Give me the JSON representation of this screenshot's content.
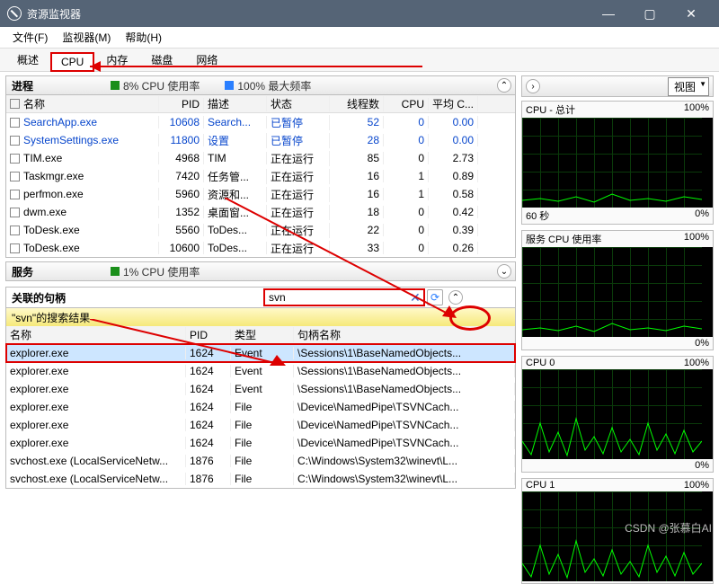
{
  "window": {
    "title": "资源监视器"
  },
  "menu": {
    "file": "文件(F)",
    "monitor": "监视器(M)",
    "help": "帮助(H)"
  },
  "tabs": [
    "概述",
    "CPU",
    "内存",
    "磁盘",
    "网络"
  ],
  "proc_panel": {
    "title": "进程",
    "m1": "8% CPU 使用率",
    "m2": "100% 最大频率"
  },
  "proc_headers": [
    "名称",
    "PID",
    "描述",
    "状态",
    "线程数",
    "CPU",
    "平均 C..."
  ],
  "processes": [
    {
      "name": "SearchApp.exe",
      "pid": "10608",
      "desc": "Search...",
      "state": "已暂停",
      "threads": "52",
      "cpu": "0",
      "avg": "0.00",
      "blue": true
    },
    {
      "name": "SystemSettings.exe",
      "pid": "11800",
      "desc": "设置",
      "state": "已暂停",
      "threads": "28",
      "cpu": "0",
      "avg": "0.00",
      "blue": true
    },
    {
      "name": "TIM.exe",
      "pid": "4968",
      "desc": "TIM",
      "state": "正在运行",
      "threads": "85",
      "cpu": "0",
      "avg": "2.73"
    },
    {
      "name": "Taskmgr.exe",
      "pid": "7420",
      "desc": "任务管...",
      "state": "正在运行",
      "threads": "16",
      "cpu": "1",
      "avg": "0.89"
    },
    {
      "name": "perfmon.exe",
      "pid": "5960",
      "desc": "资源和...",
      "state": "正在运行",
      "threads": "16",
      "cpu": "1",
      "avg": "0.58"
    },
    {
      "name": "dwm.exe",
      "pid": "1352",
      "desc": "桌面窗...",
      "state": "正在运行",
      "threads": "18",
      "cpu": "0",
      "avg": "0.42"
    },
    {
      "name": "ToDesk.exe",
      "pid": "5560",
      "desc": "ToDes...",
      "state": "正在运行",
      "threads": "22",
      "cpu": "0",
      "avg": "0.39"
    },
    {
      "name": "ToDesk.exe",
      "pid": "10600",
      "desc": "ToDes...",
      "state": "正在运行",
      "threads": "33",
      "cpu": "0",
      "avg": "0.26"
    }
  ],
  "svc_panel": {
    "title": "服务",
    "m1": "1% CPU 使用率"
  },
  "handles_panel": {
    "title": "关联的句柄"
  },
  "search": {
    "value": "svn",
    "results_label": "\"svn\"的搜索结果"
  },
  "hand_headers": [
    "名称",
    "PID",
    "类型",
    "句柄名称"
  ],
  "handles": [
    {
      "name": "explorer.exe",
      "pid": "1624",
      "type": "Event",
      "h": "\\Sessions\\1\\BaseNamedObjects...",
      "sel": true
    },
    {
      "name": "explorer.exe",
      "pid": "1624",
      "type": "Event",
      "h": "\\Sessions\\1\\BaseNamedObjects..."
    },
    {
      "name": "explorer.exe",
      "pid": "1624",
      "type": "Event",
      "h": "\\Sessions\\1\\BaseNamedObjects..."
    },
    {
      "name": "explorer.exe",
      "pid": "1624",
      "type": "File",
      "h": "\\Device\\NamedPipe\\TSVNCach..."
    },
    {
      "name": "explorer.exe",
      "pid": "1624",
      "type": "File",
      "h": "\\Device\\NamedPipe\\TSVNCach..."
    },
    {
      "name": "explorer.exe",
      "pid": "1624",
      "type": "File",
      "h": "\\Device\\NamedPipe\\TSVNCach..."
    },
    {
      "name": "svchost.exe (LocalServiceNetw...",
      "pid": "1876",
      "type": "File",
      "h": "C:\\Windows\\System32\\winevt\\L..."
    },
    {
      "name": "svchost.exe (LocalServiceNetw...",
      "pid": "1876",
      "type": "File",
      "h": "C:\\Windows\\System32\\winevt\\L..."
    }
  ],
  "right": {
    "view": "视图"
  },
  "charts": [
    {
      "title": "CPU - 总计",
      "pct": "100%",
      "btm_l": "60 秒",
      "btm_r": "0%"
    },
    {
      "title": "服务 CPU 使用率",
      "pct": "100%",
      "btm_l": "",
      "btm_r": "0%"
    },
    {
      "title": "CPU 0",
      "pct": "100%",
      "btm_l": "",
      "btm_r": "0%"
    },
    {
      "title": "CPU 1",
      "pct": "100%",
      "btm_l": "",
      "btm_r": ""
    }
  ],
  "watermark": "CSDN @张慕白AI"
}
